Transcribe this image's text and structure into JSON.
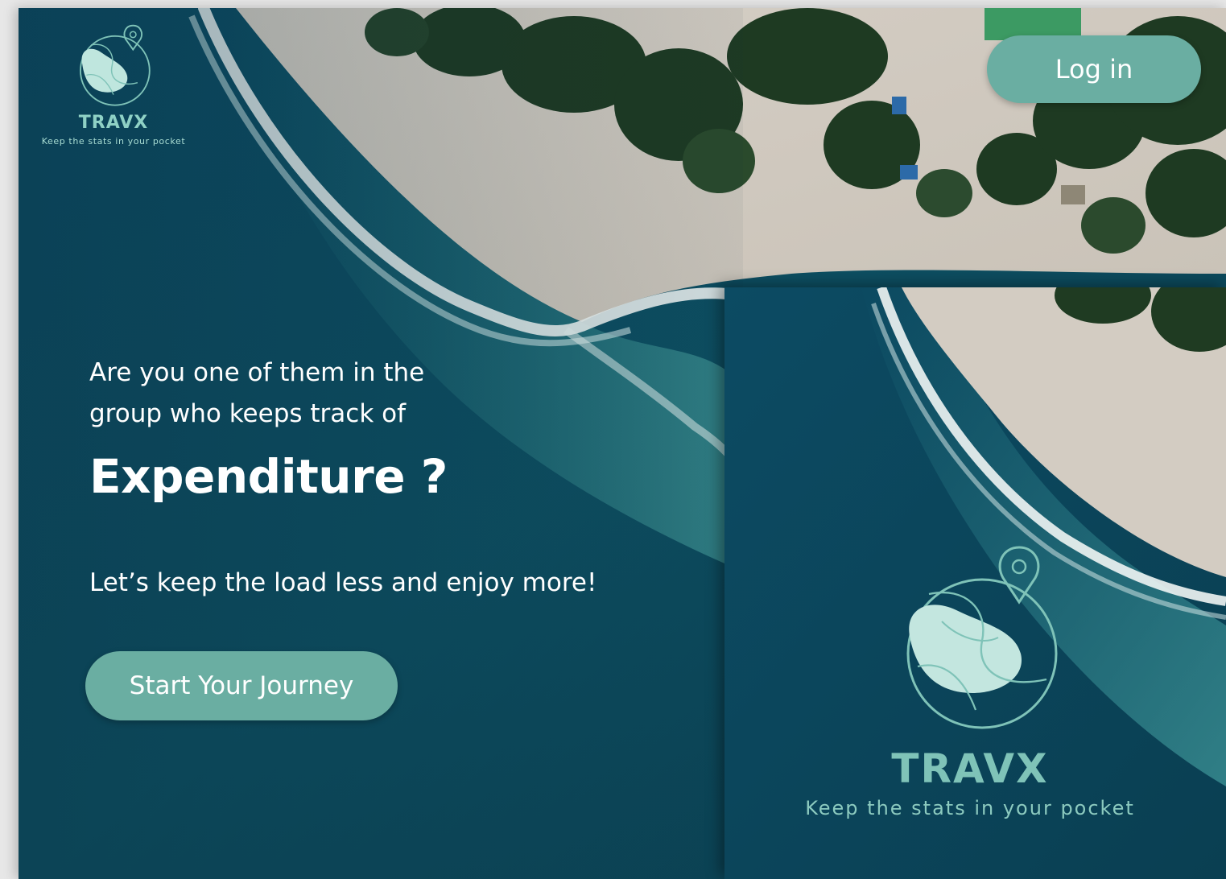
{
  "brand": {
    "name": "TRAVX",
    "tagline": "Keep the stats in your pocket"
  },
  "header": {
    "login_label": "Log in"
  },
  "hero": {
    "question": "Are you one of them in the group who keeps track of",
    "headline": "Expenditure ?",
    "subline": "Let’s keep the load less and enjoy more!",
    "cta_label": "Start Your Journey"
  },
  "splash": {
    "name": "TRAVX",
    "tagline": "Keep the stats in your pocket"
  },
  "colors": {
    "accent": "#6aaea2",
    "brand_text": "#8fd1c5",
    "ocean": "#0f4a5e",
    "sand": "#d8d2c9",
    "foliage": "#1f3b22"
  },
  "icons": {
    "logo": "globe-location-logo-icon"
  }
}
